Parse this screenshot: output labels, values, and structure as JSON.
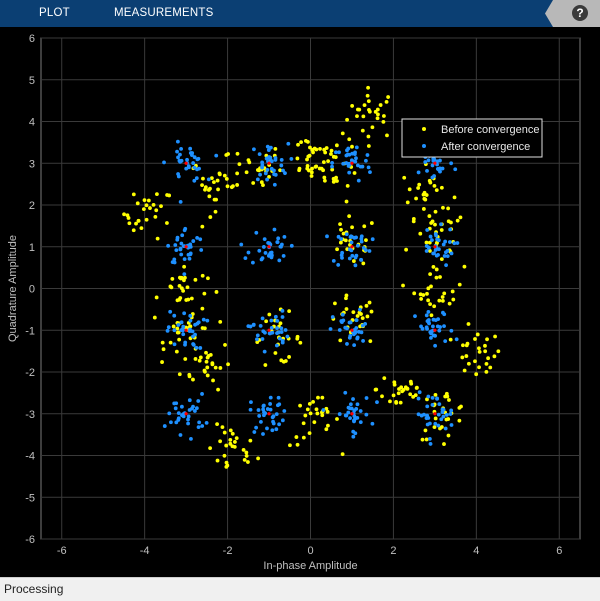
{
  "toolstrip": {
    "tabs": [
      {
        "label": "PLOT"
      },
      {
        "label": "MEASUREMENTS"
      }
    ],
    "help_label": "?",
    "help_icon": "help-icon"
  },
  "status": {
    "text": "Processing"
  },
  "colors": {
    "toolstrip_bg": "#0b3f73",
    "before": "#ffff00",
    "after": "#1e90ff",
    "reference": "#ff0000",
    "axes_bg": "#000000",
    "grid": "#3a3a3a",
    "axis_text": "#c0c0c0"
  },
  "chart_data": {
    "type": "scatter",
    "title": "",
    "xlabel": "In-phase Amplitude",
    "ylabel": "Quadrature Amplitude",
    "xlim": [
      -6.5,
      6.5
    ],
    "ylim": [
      -6,
      6
    ],
    "xticks": [
      -6,
      -4,
      -2,
      0,
      2,
      4,
      6
    ],
    "yticks": [
      -6,
      -5,
      -4,
      -3,
      -2,
      -1,
      0,
      1,
      2,
      3,
      4,
      5,
      6
    ],
    "grid": true,
    "legend_position": "top-right",
    "constellation": "16-QAM",
    "reference_points": [
      [
        -3,
        3
      ],
      [
        -1,
        3
      ],
      [
        1,
        3
      ],
      [
        3,
        3
      ],
      [
        -3,
        1
      ],
      [
        -1,
        1
      ],
      [
        1,
        1
      ],
      [
        3,
        1
      ],
      [
        -3,
        -1
      ],
      [
        -1,
        -1
      ],
      [
        1,
        -1
      ],
      [
        3,
        -1
      ],
      [
        -3,
        -3
      ],
      [
        -1,
        -3
      ],
      [
        1,
        -3
      ],
      [
        3,
        -3
      ]
    ],
    "series": [
      {
        "name": "Before convergence",
        "color": "#ffff00",
        "description": "rotated/scattered constellation clusters",
        "cluster_centers": [
          [
            1.5,
            4.2
          ],
          [
            -3.9,
            1.8
          ],
          [
            4.0,
            -1.6
          ],
          [
            -1.9,
            -3.9
          ],
          [
            -1.3,
            2.9
          ],
          [
            0.0,
            3.2
          ],
          [
            -2.5,
            -1.8
          ],
          [
            2.8,
            2.3
          ],
          [
            -3.1,
            0.0
          ],
          [
            3.1,
            0.0
          ],
          [
            -2.3,
            2.5
          ],
          [
            -0.8,
            -1.2
          ],
          [
            0.1,
            -3.2
          ],
          [
            2.2,
            -2.4
          ],
          [
            1.0,
            1.1
          ],
          [
            1.0,
            -0.8
          ],
          [
            3.1,
            1.2
          ],
          [
            -2.9,
            -1.0
          ],
          [
            0.6,
            3.0
          ],
          [
            3.2,
            -3.0
          ]
        ],
        "spread": 0.3,
        "points_per_cluster": 26
      },
      {
        "name": "After convergence",
        "color": "#1e90ff",
        "description": "clusters centered on ideal 16-QAM points",
        "spread": 0.23,
        "points_per_cluster": 32
      }
    ]
  }
}
